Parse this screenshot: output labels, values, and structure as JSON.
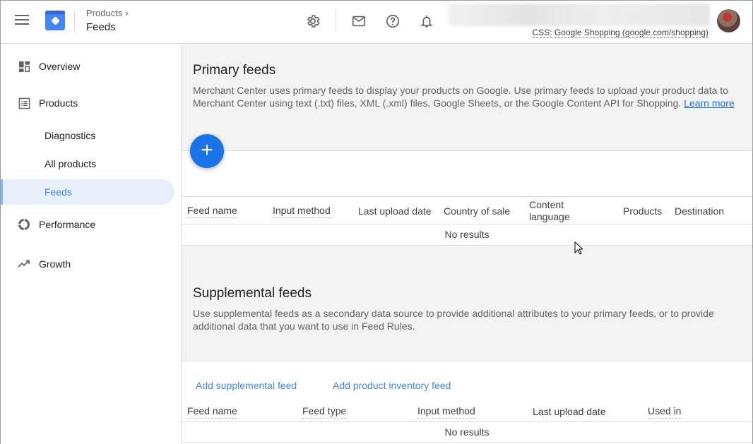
{
  "header": {
    "breadcrumb_parent": "Products",
    "breadcrumb_chevron": "›",
    "title": "Feeds",
    "account_label": "CSS: Google Shopping (google.com/shopping)",
    "icons": [
      "settings-icon",
      "mail-icon",
      "help-icon",
      "notifications-icon"
    ]
  },
  "sidebar": {
    "items": [
      {
        "label": "Overview",
        "icon": "dashboard-icon"
      },
      {
        "label": "Products",
        "icon": "list-icon"
      },
      {
        "label": "Diagnostics"
      },
      {
        "label": "All products"
      },
      {
        "label": "Feeds",
        "active": true
      },
      {
        "label": "Performance",
        "icon": "donut-icon"
      },
      {
        "label": "Growth",
        "icon": "trending-up-icon"
      }
    ]
  },
  "primary": {
    "title": "Primary feeds",
    "description": "Merchant Center uses primary feeds to display your products on Google. Use primary feeds to upload your product data to Merchant Center using text (.txt) files, XML (.xml) files, Google Sheets, or the Google Content API for Shopping.",
    "learn_more": "Learn more",
    "add_button": "+",
    "columns": [
      "Feed name",
      "Input method",
      "Last upload date",
      "Country of sale",
      "Content language",
      "Products",
      "Destination"
    ],
    "empty": "No results"
  },
  "supplemental": {
    "title": "Supplemental feeds",
    "description": "Use supplemental feeds as a secondary data source to provide additional attributes to your primary feeds, or to provide additional data that you want to use in Feed Rules.",
    "add_supplemental": "Add supplemental feed",
    "add_inventory": "Add product inventory feed",
    "columns": [
      "Feed name",
      "Feed type",
      "Input method",
      "Last upload date",
      "Used in"
    ],
    "empty": "No results"
  },
  "colors": {
    "accent": "#1a73e8",
    "active_nav_bg": "#e8f0fe"
  }
}
